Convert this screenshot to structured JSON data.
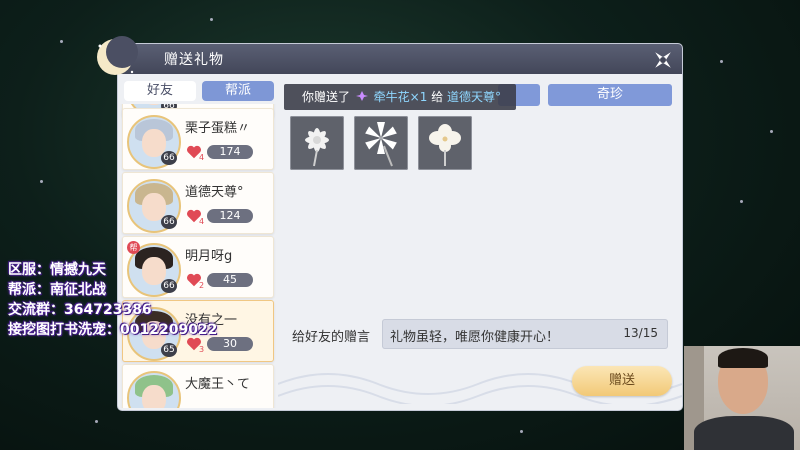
{
  "window": {
    "title": "赠送礼物"
  },
  "left_tabs": [
    {
      "label": "好友",
      "active": true
    },
    {
      "label": "帮派",
      "active": false
    }
  ],
  "friends": [
    {
      "name": "栗子蛋糕〃",
      "level": "66",
      "hearts": "4",
      "affinity": "174",
      "badge": "",
      "hair": "#b9c6d8"
    },
    {
      "name": "道德天尊°",
      "level": "66",
      "hearts": "4",
      "affinity": "124",
      "badge": "",
      "hair": "#c9b68f"
    },
    {
      "name": "明月呀g",
      "level": "66",
      "hearts": "2",
      "affinity": "45",
      "badge": "帮",
      "hair": "#2b2320"
    },
    {
      "name": "没有之一",
      "level": "65",
      "hearts": "3",
      "affinity": "30",
      "badge": "",
      "hair": "#3a2c26"
    },
    {
      "name": "大魔王丶て",
      "level": "",
      "hearts": "",
      "affinity": "",
      "badge": "",
      "hair": "#8fc28a"
    }
  ],
  "right_tabs": {
    "rare": "奇珍"
  },
  "toast": {
    "prefix": "你赠送了",
    "item": "牵牛花×1",
    "middle": "给",
    "target": "道德天尊°"
  },
  "gift_items": [
    {
      "name": "daisy-flower",
      "color": "#f2f2f2"
    },
    {
      "name": "lily-flower",
      "color": "#ffffff"
    },
    {
      "name": "orchid-flower",
      "color": "#f7f4ec"
    }
  ],
  "message": {
    "label": "给好友的赠言",
    "text": "礼物虽轻，唯愿你健康开心！",
    "count": "13/15"
  },
  "send_button": "赠送",
  "overlay": {
    "server": "区服：情撼九天",
    "guild": "帮派：南征北战",
    "group": "交流群：364723386",
    "contact": "接挖图打书洗宠：0012209022"
  },
  "colors": {
    "accent": "#8099d9",
    "send": "#f2c977",
    "heart": "#e04a55"
  }
}
